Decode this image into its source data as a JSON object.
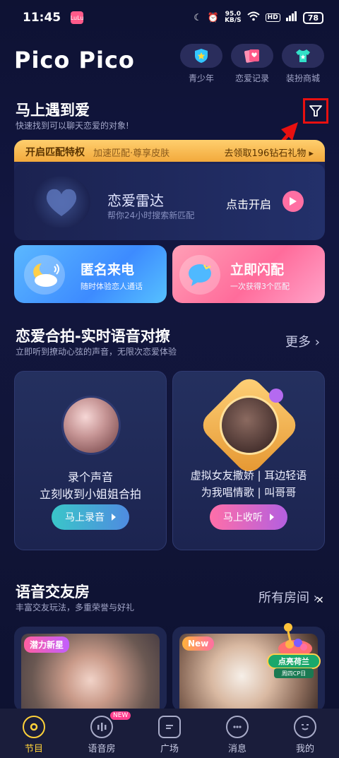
{
  "status": {
    "time": "11:45",
    "app_badge": "LuLu",
    "speed_value": "95.0",
    "speed_unit": "KB/S",
    "hd": "HD",
    "battery": "78"
  },
  "header": {
    "logo": "Pico Pico",
    "items": [
      {
        "label": "青少年"
      },
      {
        "label": "恋爱记录"
      },
      {
        "label": "装扮商城"
      }
    ]
  },
  "love_section": {
    "title": "马上遇到爱",
    "subtitle": "快速找到可以聊天恋爱的对象!"
  },
  "match_privilege": {
    "left": "开启匹配特权",
    "middle": "加速匹配·尊享皮肤",
    "right": "去领取196钻石礼物"
  },
  "radar": {
    "title": "恋爱雷达",
    "subtitle": "帮你24小时搜索新匹配",
    "cta": "点击开启"
  },
  "tiles": [
    {
      "title": "匿名来电",
      "subtitle": "随时体验恋人通话"
    },
    {
      "title": "立即闪配",
      "subtitle": "一次获得3个匹配"
    }
  ],
  "voice_section": {
    "title": "恋爱合拍-实时语音对撩",
    "subtitle": "立即听到撩动心弦的声音，无限次恋爱体验",
    "more": "更多"
  },
  "duo_cards": [
    {
      "line1": "录个声音",
      "line2": "立刻收到小姐姐合拍",
      "button": "马上录音"
    },
    {
      "line1": "虚拟女友撒娇 | 耳边轻语",
      "line2": "为我唱情歌 | 叫哥哥",
      "button": "马上收听"
    }
  ],
  "rooms_section": {
    "title": "语音交友房",
    "subtitle": "丰富交友玩法，多重荣誉与好礼",
    "more": "所有房间"
  },
  "rooms": [
    {
      "tag": "潜力新星"
    },
    {
      "tag": "New"
    }
  ],
  "promo": {
    "label": "点亮荷兰",
    "sub": "周四CP日"
  },
  "tabbar": {
    "items": [
      {
        "label": "节目",
        "active": true
      },
      {
        "label": "语音房",
        "badge": "NEW"
      },
      {
        "label": "广场"
      },
      {
        "label": "消息"
      },
      {
        "label": "我的"
      }
    ]
  },
  "colors": {
    "accent_yellow": "#ffd23a",
    "pink": "#ff6fa3",
    "annotation_red": "#e81010"
  }
}
